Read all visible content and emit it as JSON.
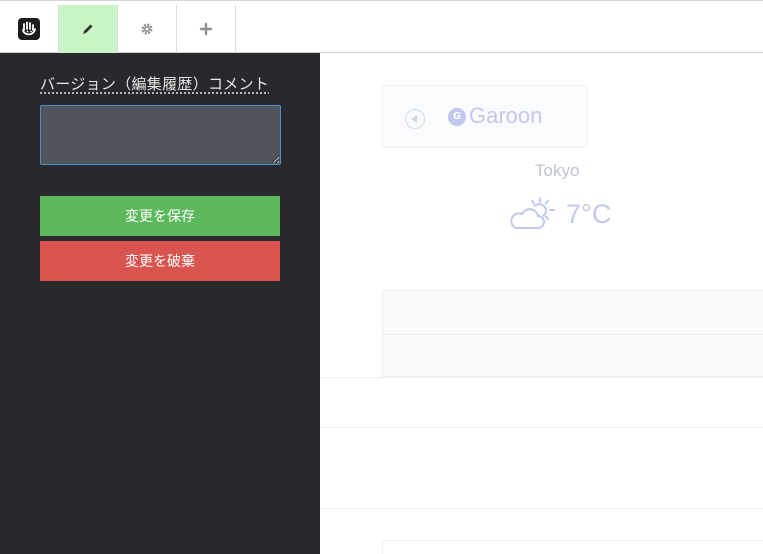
{
  "toolbar": {
    "items": [
      {
        "icon": "concrete5-logo-icon"
      },
      {
        "icon": "pencil-icon",
        "active": true
      },
      {
        "icon": "gear-icon"
      },
      {
        "icon": "plus-icon"
      }
    ],
    "active_color": "#c9f5c5"
  },
  "panel": {
    "comment_label": "バージョン（編集履歴）コメント",
    "comment_value": "",
    "save_label": "変更を保存",
    "discard_label": "変更を破棄",
    "save_color": "#5cb85c",
    "discard_color": "#d9534f",
    "background": "#27292d"
  },
  "content": {
    "widget": {
      "back_icon": "circle-back-arrow-icon",
      "logo_icon": "garoon-g-logo-icon",
      "logo_letter": "G",
      "name": "Garoon"
    },
    "weather": {
      "city": "Tokyo",
      "icon": "partly-cloudy-icon",
      "temperature": "7°C"
    }
  }
}
